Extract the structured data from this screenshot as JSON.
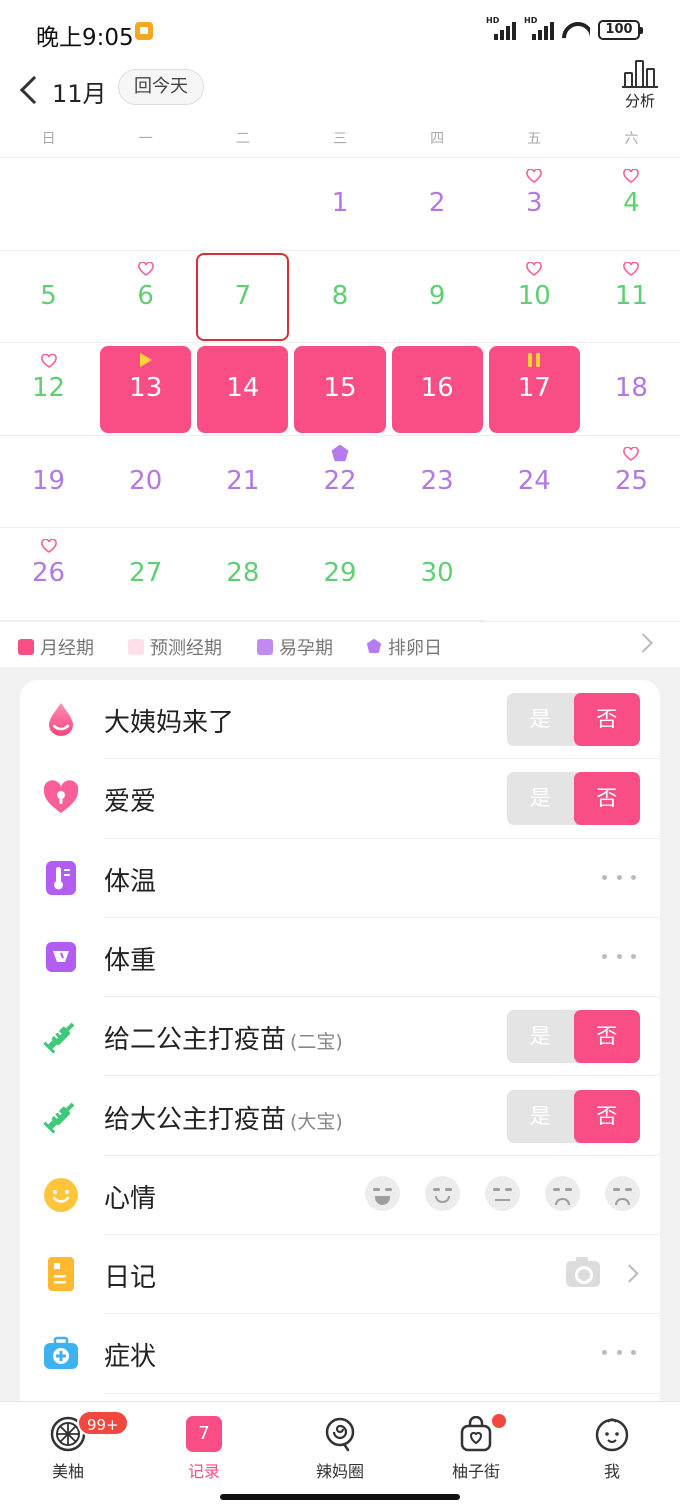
{
  "status_bar": {
    "time": "晚上9:05",
    "battery": "100"
  },
  "header": {
    "month": "11月",
    "today_button": "回今天",
    "analyze_label": "分析"
  },
  "weekdays": [
    "日",
    "一",
    "二",
    "三",
    "四",
    "五",
    "六"
  ],
  "calendar": {
    "rows": [
      [
        null,
        null,
        null,
        {
          "d": "1",
          "c": "purple"
        },
        {
          "d": "2",
          "c": "purple"
        },
        {
          "d": "3",
          "c": "purple",
          "heart": true
        },
        {
          "d": "4",
          "c": "green",
          "heart": true
        }
      ],
      [
        {
          "d": "5",
          "c": "green"
        },
        {
          "d": "6",
          "c": "green",
          "heart": true
        },
        {
          "d": "7",
          "c": "green",
          "today": true
        },
        {
          "d": "8",
          "c": "green"
        },
        {
          "d": "9",
          "c": "green"
        },
        {
          "d": "10",
          "c": "green",
          "heart": true
        },
        {
          "d": "11",
          "c": "green",
          "heart": true
        }
      ],
      [
        {
          "d": "12",
          "c": "green",
          "heart": true
        },
        {
          "d": "13",
          "c": "period",
          "mark": "flag"
        },
        {
          "d": "14",
          "c": "period"
        },
        {
          "d": "15",
          "c": "period"
        },
        {
          "d": "16",
          "c": "period"
        },
        {
          "d": "17",
          "c": "period",
          "mark": "pause"
        },
        {
          "d": "18",
          "c": "purple"
        }
      ],
      [
        {
          "d": "19",
          "c": "purple"
        },
        {
          "d": "20",
          "c": "purple"
        },
        {
          "d": "21",
          "c": "purple"
        },
        {
          "d": "22",
          "c": "purple",
          "mark": "flower"
        },
        {
          "d": "23",
          "c": "purple"
        },
        {
          "d": "24",
          "c": "purple"
        },
        {
          "d": "25",
          "c": "purple",
          "heart": true
        }
      ],
      [
        {
          "d": "26",
          "c": "purple",
          "heart": true
        },
        {
          "d": "27",
          "c": "green"
        },
        {
          "d": "28",
          "c": "green"
        },
        {
          "d": "29",
          "c": "green"
        },
        {
          "d": "30",
          "c": "green"
        },
        null,
        null
      ]
    ]
  },
  "legend": {
    "period": "月经期",
    "predicted": "预测经期",
    "fertile": "易孕期",
    "ovulation": "排卵日",
    "colors": {
      "period": "#f94d85",
      "predicted": "#fde0ea",
      "fertile": "#c08af0",
      "ovulation": "#b57cef"
    }
  },
  "records": {
    "period": {
      "label": "大姨妈来了",
      "yes": "是",
      "no": "否"
    },
    "love": {
      "label": "爱爱",
      "yes": "是",
      "no": "否"
    },
    "temperature": {
      "label": "体温"
    },
    "weight": {
      "label": "体重"
    },
    "vaccine2": {
      "label": "给二公主打疫苗",
      "sub": "(二宝)",
      "yes": "是",
      "no": "否"
    },
    "vaccine1": {
      "label": "给大公主打疫苗",
      "sub": "(大宝)",
      "yes": "是",
      "no": "否"
    },
    "mood": {
      "label": "心情"
    },
    "diary": {
      "label": "日记"
    },
    "symptoms": {
      "label": "症状"
    }
  },
  "bottom_nav": {
    "meiyou": "美柚",
    "meiyou_badge": "99+",
    "record": "记录",
    "record_day": "7",
    "lamaquan": "辣妈圈",
    "youzijie": "柚子街",
    "me": "我"
  },
  "accent": "#f94d85"
}
